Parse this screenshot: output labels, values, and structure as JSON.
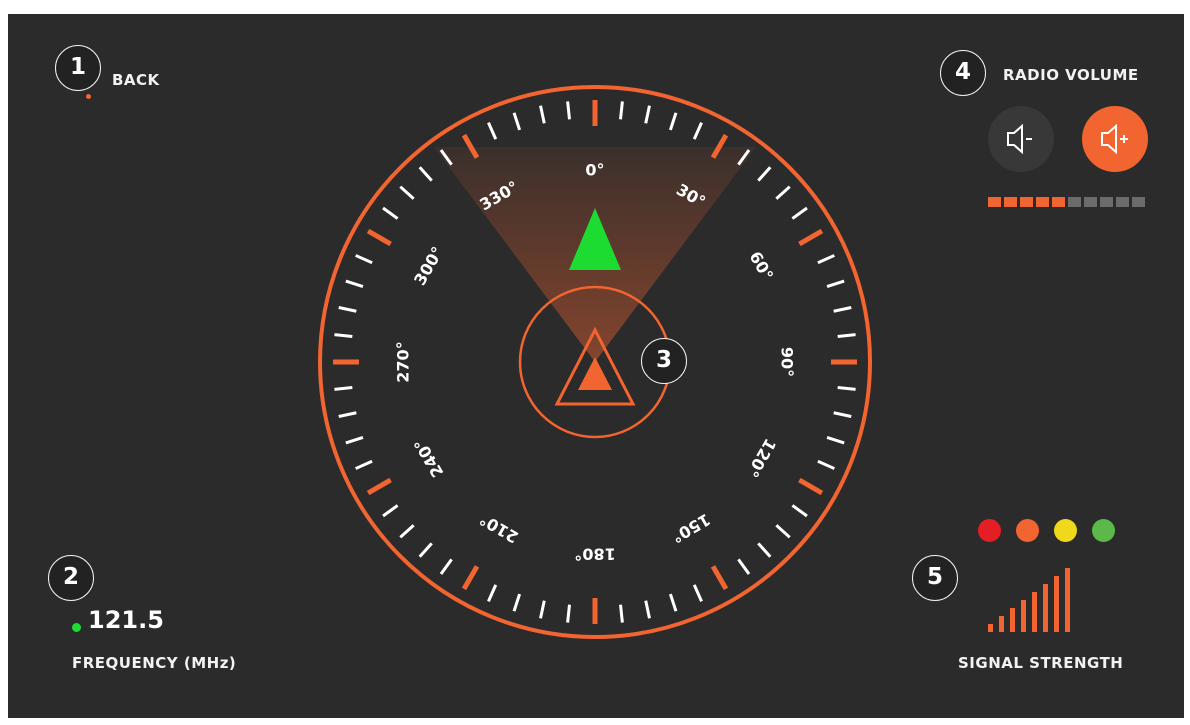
{
  "back": {
    "badge": "1",
    "label": "BACK"
  },
  "frequency": {
    "badge": "2",
    "value": "121.5",
    "label": "FREQUENCY (MHz)",
    "status_color": "#1ddc31"
  },
  "compass": {
    "badge": "3",
    "ring_color": "#f26430",
    "tick_color": "#ffffff",
    "heading_labels": [
      "0°",
      "30°",
      "60°",
      "90°",
      "120°",
      "150°",
      "180°",
      "210°",
      "240°",
      "270°",
      "300°",
      "330°"
    ],
    "beacon_color": "#1ddc31"
  },
  "radio_volume": {
    "badge": "4",
    "label": "RADIO VOLUME",
    "level": 5,
    "max_level": 10,
    "active_color": "#f26430",
    "inactive_color": "#6b6b6b"
  },
  "signal_strength": {
    "badge": "5",
    "label": "SIGNAL STRENGTH",
    "bars": 8,
    "led_colors": [
      "#e31e24",
      "#f26430",
      "#f0d81a",
      "#5cb848"
    ]
  }
}
